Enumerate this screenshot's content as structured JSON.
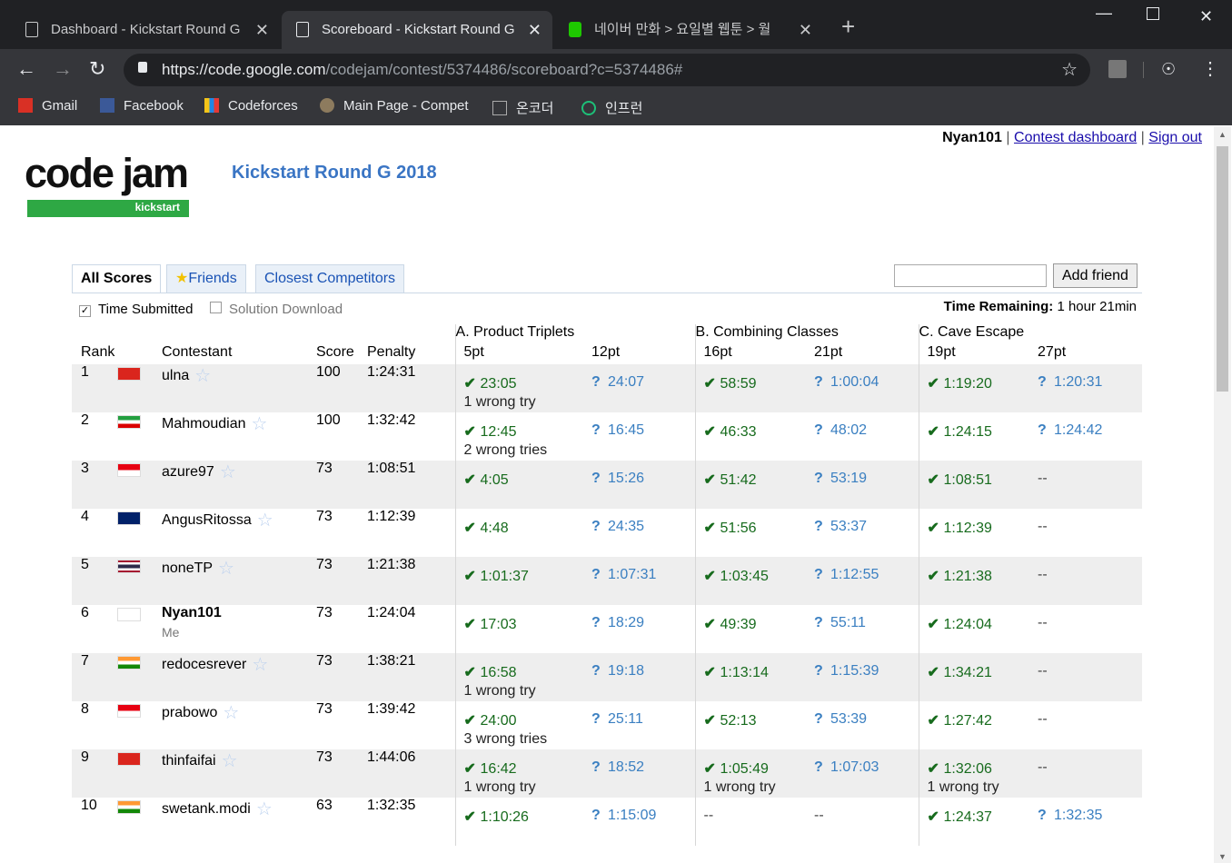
{
  "browser": {
    "tabs": [
      {
        "title": "Dashboard - Kickstart Round G",
        "active": false
      },
      {
        "title": "Scoreboard - Kickstart Round G",
        "active": true
      },
      {
        "title": "네이버 만화 > 요일별 웹툰 > 월",
        "active": false
      }
    ],
    "close_glyph": "✕",
    "new_tab_glyph": "+",
    "url_host": "https://code.google.com",
    "url_path": "/codejam/contest/5374486/scoreboard?c=5374486#",
    "bookmarks": [
      "Gmail",
      "Facebook",
      "Codeforces",
      "Main Page - Compet",
      "온코더",
      "인프런"
    ]
  },
  "header": {
    "username": "Nyan101",
    "separator": "|",
    "dashboard_link": "Contest dashboard",
    "signout_link": "Sign out",
    "contest_title": "Kickstart Round G 2018",
    "logo_text": "code jam",
    "logo_sub": "kickstart"
  },
  "tabs": {
    "all": "All Scores",
    "friends": "Friends",
    "closest": "Closest Competitors"
  },
  "add_friend_label": "Add friend",
  "options": {
    "time_submitted": "Time Submitted",
    "solution_download": "Solution Download"
  },
  "time_remaining_label": "Time Remaining:",
  "time_remaining_value": "1 hour 21min",
  "columns": {
    "rank": "Rank",
    "contestant": "Contestant",
    "score": "Score",
    "penalty": "Penalty"
  },
  "problems": [
    {
      "name": "A. Product Triplets",
      "small": "5pt",
      "large": "12pt"
    },
    {
      "name": "B. Combining Classes",
      "small": "16pt",
      "large": "21pt"
    },
    {
      "name": "C. Cave Escape",
      "small": "19pt",
      "large": "27pt"
    }
  ],
  "rows": [
    {
      "rank": "1",
      "flag": "vn",
      "name": "ulna",
      "score": "100",
      "penalty": "1:24:31",
      "cells": [
        [
          "ok",
          "23:05",
          "1 wrong try"
        ],
        [
          "q",
          "24:07",
          ""
        ],
        [
          "ok",
          "58:59",
          ""
        ],
        [
          "q",
          "1:00:04",
          ""
        ],
        [
          "ok",
          "1:19:20",
          ""
        ],
        [
          "q",
          "1:20:31",
          ""
        ]
      ]
    },
    {
      "rank": "2",
      "flag": "ir",
      "name": "Mahmoudian",
      "score": "100",
      "penalty": "1:32:42",
      "cells": [
        [
          "ok",
          "12:45",
          "2 wrong tries"
        ],
        [
          "q",
          "16:45",
          ""
        ],
        [
          "ok",
          "46:33",
          ""
        ],
        [
          "q",
          "48:02",
          ""
        ],
        [
          "ok",
          "1:24:15",
          ""
        ],
        [
          "q",
          "1:24:42",
          ""
        ]
      ]
    },
    {
      "rank": "3",
      "flag": "id",
      "name": "azure97",
      "score": "73",
      "penalty": "1:08:51",
      "cells": [
        [
          "ok",
          "4:05",
          ""
        ],
        [
          "q",
          "15:26",
          ""
        ],
        [
          "ok",
          "51:42",
          ""
        ],
        [
          "q",
          "53:19",
          ""
        ],
        [
          "ok",
          "1:08:51",
          ""
        ],
        [
          "none",
          "--",
          ""
        ]
      ]
    },
    {
      "rank": "4",
      "flag": "au",
      "name": "AngusRitossa",
      "score": "73",
      "penalty": "1:12:39",
      "cells": [
        [
          "ok",
          "4:48",
          ""
        ],
        [
          "q",
          "24:35",
          ""
        ],
        [
          "ok",
          "51:56",
          ""
        ],
        [
          "q",
          "53:37",
          ""
        ],
        [
          "ok",
          "1:12:39",
          ""
        ],
        [
          "none",
          "--",
          ""
        ]
      ]
    },
    {
      "rank": "5",
      "flag": "th",
      "name": "noneTP",
      "score": "73",
      "penalty": "1:21:38",
      "cells": [
        [
          "ok",
          "1:01:37",
          ""
        ],
        [
          "q",
          "1:07:31",
          ""
        ],
        [
          "ok",
          "1:03:45",
          ""
        ],
        [
          "q",
          "1:12:55",
          ""
        ],
        [
          "ok",
          "1:21:38",
          ""
        ],
        [
          "none",
          "--",
          ""
        ]
      ]
    },
    {
      "rank": "6",
      "flag": "kr",
      "name": "Nyan101",
      "me": "Me",
      "score": "73",
      "penalty": "1:24:04",
      "cells": [
        [
          "ok",
          "17:03",
          ""
        ],
        [
          "q",
          "18:29",
          ""
        ],
        [
          "ok",
          "49:39",
          ""
        ],
        [
          "q",
          "55:11",
          ""
        ],
        [
          "ok",
          "1:24:04",
          ""
        ],
        [
          "none",
          "--",
          ""
        ]
      ]
    },
    {
      "rank": "7",
      "flag": "in",
      "name": "redocesrever",
      "score": "73",
      "penalty": "1:38:21",
      "cells": [
        [
          "ok",
          "16:58",
          "1 wrong try"
        ],
        [
          "q",
          "19:18",
          ""
        ],
        [
          "ok",
          "1:13:14",
          ""
        ],
        [
          "q",
          "1:15:39",
          ""
        ],
        [
          "ok",
          "1:34:21",
          ""
        ],
        [
          "none",
          "--",
          ""
        ]
      ]
    },
    {
      "rank": "8",
      "flag": "id",
      "name": "prabowo",
      "score": "73",
      "penalty": "1:39:42",
      "cells": [
        [
          "ok",
          "24:00",
          "3 wrong tries"
        ],
        [
          "q",
          "25:11",
          ""
        ],
        [
          "ok",
          "52:13",
          ""
        ],
        [
          "q",
          "53:39",
          ""
        ],
        [
          "ok",
          "1:27:42",
          ""
        ],
        [
          "none",
          "--",
          ""
        ]
      ]
    },
    {
      "rank": "9",
      "flag": "vn",
      "name": "thinfaifai",
      "score": "73",
      "penalty": "1:44:06",
      "cells": [
        [
          "ok",
          "16:42",
          "1 wrong try"
        ],
        [
          "q",
          "18:52",
          ""
        ],
        [
          "ok",
          "1:05:49",
          "1 wrong try"
        ],
        [
          "q",
          "1:07:03",
          ""
        ],
        [
          "ok",
          "1:32:06",
          "1 wrong try"
        ],
        [
          "none",
          "--",
          ""
        ]
      ]
    },
    {
      "rank": "10",
      "flag": "in",
      "name": "swetank.modi",
      "score": "63",
      "penalty": "1:32:35",
      "cells": [
        [
          "ok",
          "1:10:26",
          ""
        ],
        [
          "q",
          "1:15:09",
          ""
        ],
        [
          "none",
          "--",
          ""
        ],
        [
          "none",
          "--",
          ""
        ],
        [
          "ok",
          "1:24:37",
          ""
        ],
        [
          "q",
          "1:32:35",
          ""
        ]
      ]
    }
  ],
  "glyphs": {
    "ok": "✔",
    "q": "?",
    "star": "☆",
    "friend_star": "★"
  }
}
